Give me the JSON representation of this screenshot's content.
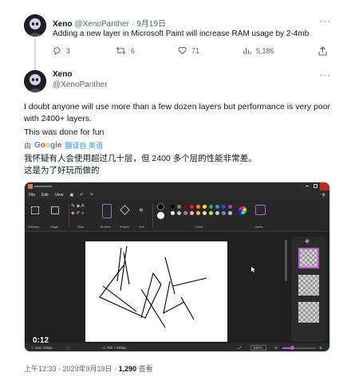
{
  "tweet1": {
    "name": "Xeno",
    "handle": "@XenoPanther",
    "date": "9月19日",
    "text": "Adding a new layer in Microsoft Paint will increase RAM usage by 2-4mb",
    "replies": "3",
    "retweets": "6",
    "likes": "71",
    "views": "5,186"
  },
  "tweet2": {
    "name": "Xeno",
    "handle": "@XenoPanther",
    "text1": "I doubt anyone will use more than a few dozen layers but performance is very poor with 2400+ layers.",
    "text2": "This was done for fun",
    "translate_by": "由",
    "google": "Google",
    "translate_from": "翻译自 英语",
    "translation1": "我怀疑有人会使用超过几十层，但 2400 多个层的性能非常差。",
    "translation2": "这是为了好玩而做的"
  },
  "paint": {
    "menu": [
      "File",
      "Edit",
      "View"
    ],
    "ribbon_groups": [
      "Selection",
      "Image",
      "Tools",
      "Brushes",
      "Shapes",
      "Size",
      "Colors",
      "Layers"
    ],
    "video_time": "0:12",
    "status_pos": "↖ 423, 208px",
    "status_size": "▭ 795 × 598px",
    "zoom": "100%",
    "palette": [
      "#000000",
      "#7f7f7f",
      "#880015",
      "#ed1c24",
      "#ff7f27",
      "#fff200",
      "#22b14c",
      "#00a2e8",
      "#3f48cc",
      "#a349a4",
      "#ffffff",
      "#c3c3c3",
      "#b97a57",
      "#ffaec9",
      "#ffc90e",
      "#efe4b0",
      "#b5e61d",
      "#99d9ea",
      "#7092be",
      "#c8bfe7"
    ]
  },
  "footer": {
    "time": "上午12:33 · 2023年9月19日 · ",
    "views": "1,290",
    "views_label": " 查看"
  }
}
